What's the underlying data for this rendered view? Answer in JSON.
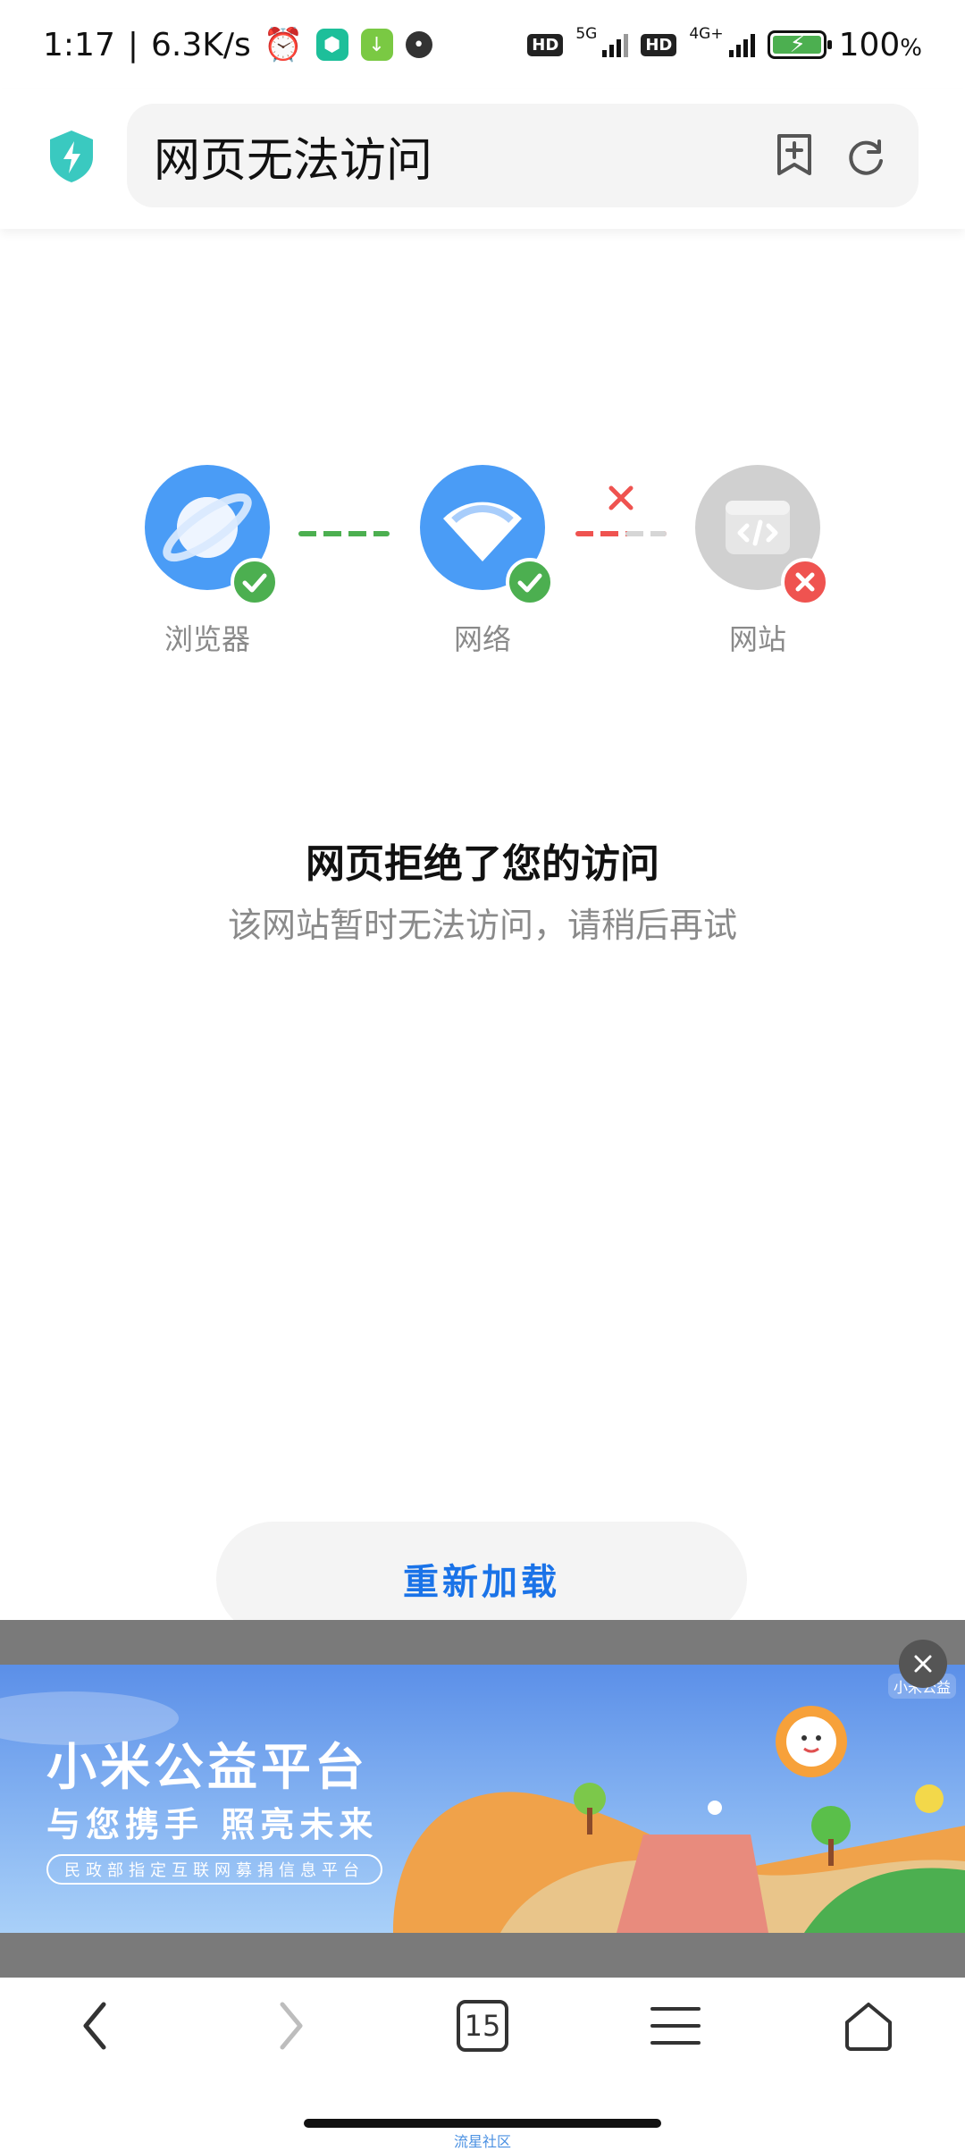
{
  "status_bar": {
    "time": "1:17",
    "speed": "6.3K/s",
    "hd1": "HD",
    "net1": "5G",
    "hd2": "HD",
    "net2": "4G+",
    "battery": "100",
    "battery_unit": "%"
  },
  "address_bar": {
    "url_text": "网页无法访问"
  },
  "diagram": {
    "browser_label": "浏览器",
    "network_label": "网络",
    "website_label": "网站"
  },
  "error": {
    "title": "网页拒绝了您的访问",
    "subtitle": "该网站暂时无法访问，请稍后再试"
  },
  "reload_button": "重新加载",
  "ad": {
    "brand": "小米公益",
    "title": "小米公益平台",
    "slogan": "与您携手 照亮未来",
    "caption": "民政部指定互联网募捐信息平台"
  },
  "bottom_nav": {
    "tab_count": "15"
  },
  "watermark": "流星社区",
  "colors": {
    "accent_blue": "#1a73e8",
    "browser_node": "#4a9cf6",
    "check_green": "#4caf50",
    "error_red": "#ef5350",
    "website_node": "#d0d0d0"
  }
}
